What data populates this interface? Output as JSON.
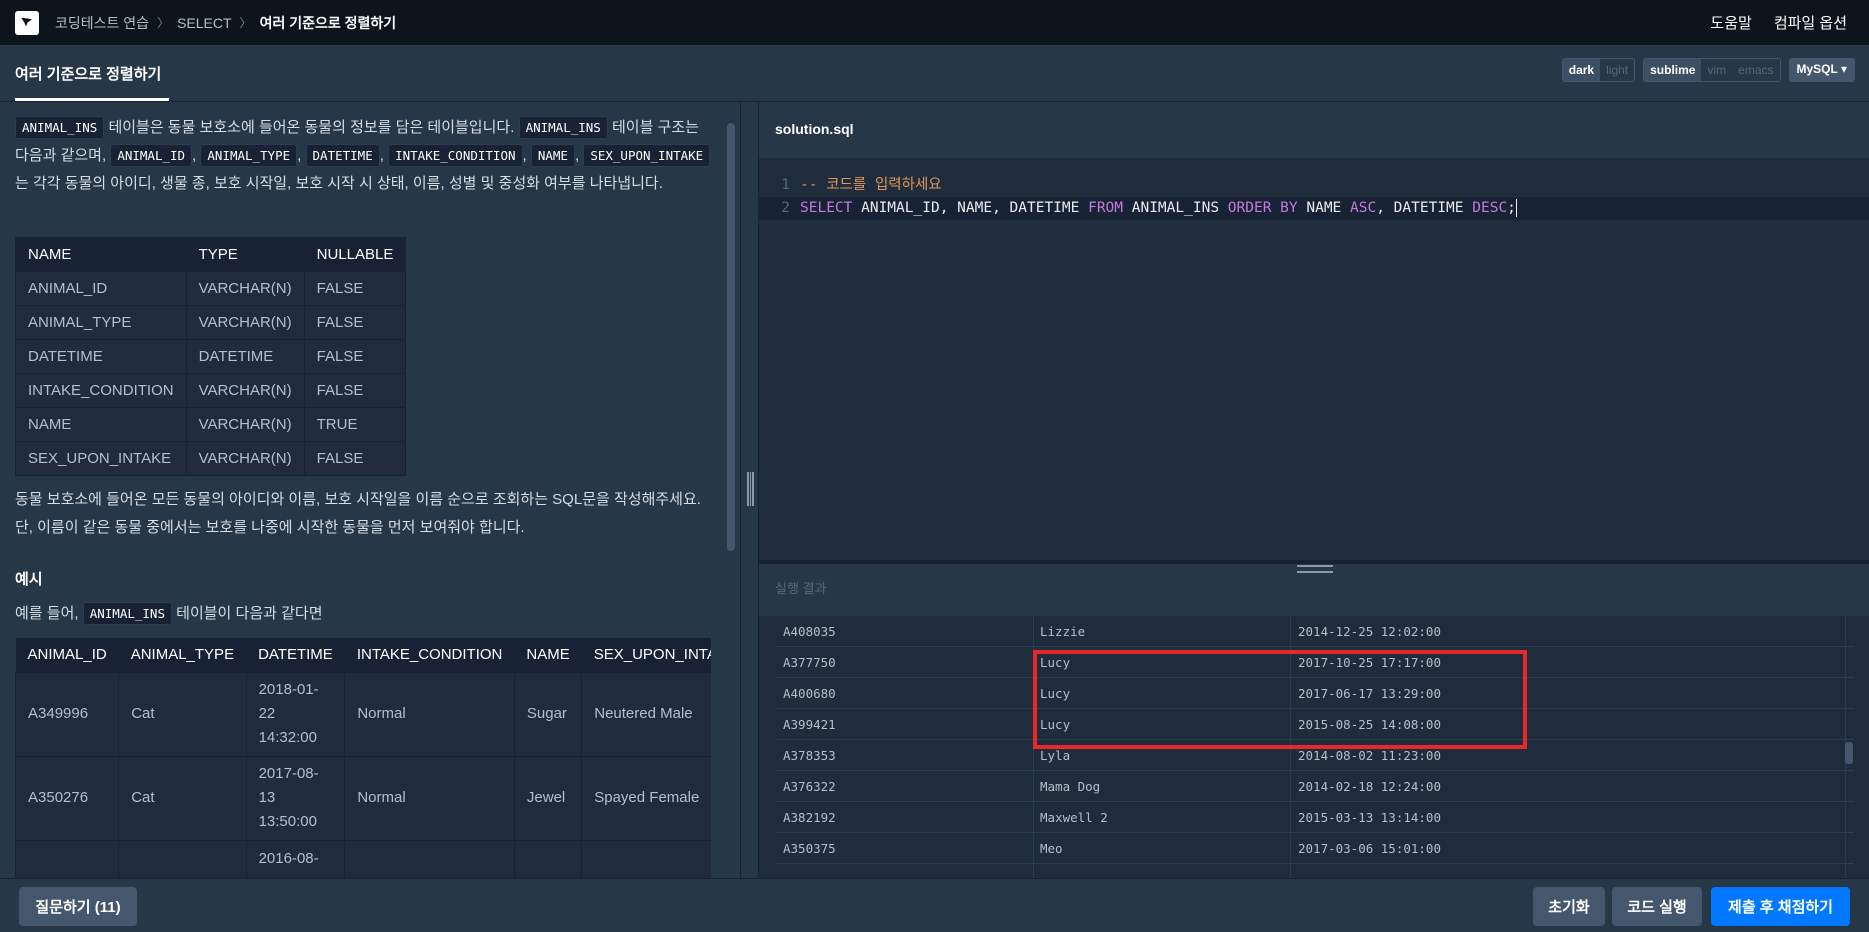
{
  "breadcrumb": [
    "코딩테스트 연습",
    "SELECT",
    "여러 기준으로 정렬하기"
  ],
  "topnav": {
    "help": "도움말",
    "compile_options": "컴파일 옵션"
  },
  "lesson_title": "여러 기준으로 정렬하기",
  "toggles": {
    "theme": [
      "dark",
      "light"
    ],
    "keymap": [
      "sublime",
      "vim",
      "emacs"
    ],
    "language": "MySQL"
  },
  "description": {
    "table_name": "ANIMAL_INS",
    "t1": "테이블은 동물 보호소에 들어온 동물의 정보를 담은 테이블입니다.",
    "t2": "테이블 구조는 다음과 같으며,",
    "cols": [
      "ANIMAL_ID",
      "ANIMAL_TYPE",
      "DATETIME",
      "INTAKE_CONDITION",
      "NAME",
      "SEX_UPON_INTAKE"
    ],
    "t3": "는 각각 동물의 아이디, 생물 종, 보호 시작일, 보호 시작 시 상태, 이름, 성별 및 중성화 여부를 나타냅니다.",
    "comma": ","
  },
  "schema": {
    "headers": [
      "NAME",
      "TYPE",
      "NULLABLE"
    ],
    "rows": [
      [
        "ANIMAL_ID",
        "VARCHAR(N)",
        "FALSE"
      ],
      [
        "ANIMAL_TYPE",
        "VARCHAR(N)",
        "FALSE"
      ],
      [
        "DATETIME",
        "DATETIME",
        "FALSE"
      ],
      [
        "INTAKE_CONDITION",
        "VARCHAR(N)",
        "FALSE"
      ],
      [
        "NAME",
        "VARCHAR(N)",
        "TRUE"
      ],
      [
        "SEX_UPON_INTAKE",
        "VARCHAR(N)",
        "FALSE"
      ]
    ]
  },
  "problem": "동물 보호소에 들어온 모든 동물의 아이디와 이름, 보호 시작일을 이름 순으로 조회하는 SQL문을 작성해주세요. 단, 이름이 같은 동물 중에서는 보호를 나중에 시작한 동물을 먼저 보여줘야 합니다.",
  "example": {
    "heading": "예시",
    "lead": "예를 들어,",
    "lead_table": "ANIMAL_INS",
    "lead_tail": "테이블이 다음과 같다면",
    "headers": [
      "ANIMAL_ID",
      "ANIMAL_TYPE",
      "DATETIME",
      "INTAKE_CONDITION",
      "NAME",
      "SEX_UPON_INTAKE"
    ],
    "rows": [
      [
        "A349996",
        "Cat",
        "2018-01-22 14:32:00",
        "Normal",
        "Sugar",
        "Neutered Male"
      ],
      [
        "A350276",
        "Cat",
        "2017-08-13 13:50:00",
        "Normal",
        "Jewel",
        "Spayed Female"
      ],
      [
        "",
        "",
        "2016-08-",
        "",
        "",
        ""
      ]
    ]
  },
  "editor": {
    "filename": "solution.sql",
    "line1": "-- 코드를 입력하세요",
    "line2": {
      "kw1": "SELECT",
      "t1": " ANIMAL_ID, NAME, DATETIME ",
      "kw2": "FROM",
      "t2": " ANIMAL_INS ",
      "kw3": "ORDER BY",
      "t3": " NAME ",
      "kw4": "ASC",
      "t4": ", DATETIME ",
      "kw5": "DESC",
      "t5": ";"
    },
    "line_numbers": [
      "1",
      "2"
    ]
  },
  "results": {
    "label": "실행 결과",
    "rows": [
      [
        "A408035",
        "Lizzie",
        "2014-12-25 12:02:00"
      ],
      [
        "A377750",
        "Lucy",
        "2017-10-25 17:17:00"
      ],
      [
        "A400680",
        "Lucy",
        "2017-06-17 13:29:00"
      ],
      [
        "A399421",
        "Lucy",
        "2015-08-25 14:08:00"
      ],
      [
        "A378353",
        "Lyla",
        "2014-08-02 11:23:00"
      ],
      [
        "A376322",
        "Mama Dog",
        "2014-02-18 12:24:00"
      ],
      [
        "A382192",
        "Maxwell 2",
        "2015-03-13 13:14:00"
      ],
      [
        "A350375",
        "Meo",
        "2017-03-06 15:01:00"
      ]
    ]
  },
  "bottom": {
    "ask": "질문하기 (11)",
    "reset": "초기화",
    "run": "코드 실행",
    "submit": "제출 후 채점하기"
  },
  "colors": {
    "accent": "#0078ff",
    "highlight": "#e52929",
    "keyword": "#c678dd",
    "comment": "#e0965b"
  }
}
